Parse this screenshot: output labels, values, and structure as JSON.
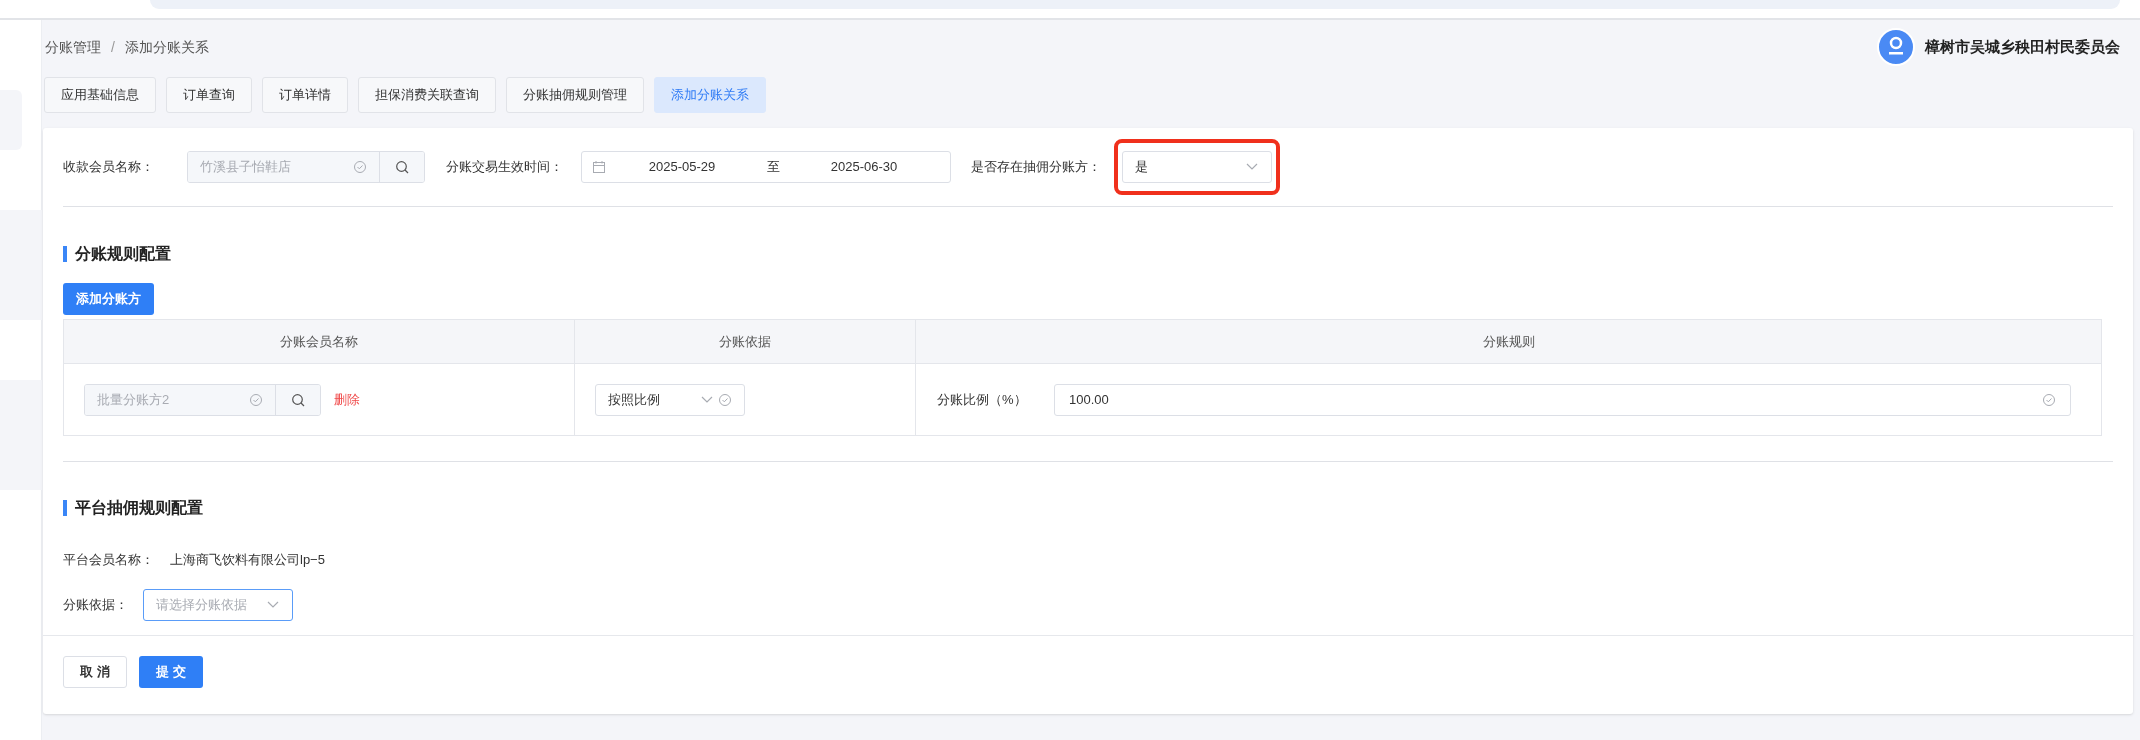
{
  "breadcrumb": {
    "items": [
      "分账管理",
      "添加分账关系"
    ],
    "separator": "/"
  },
  "user": {
    "name": "樟树市吴城乡秧田村民委员会"
  },
  "tabs": [
    {
      "label": "应用基础信息",
      "selected": false
    },
    {
      "label": "订单查询",
      "selected": false
    },
    {
      "label": "订单详情",
      "selected": false
    },
    {
      "label": "担保消费关联查询",
      "selected": false
    },
    {
      "label": "分账抽佣规则管理",
      "selected": false
    },
    {
      "label": "添加分账关系",
      "selected": true
    }
  ],
  "filters": {
    "member": {
      "label": "收款会员名称：",
      "value": "竹溪县子怡鞋店",
      "disabled": true
    },
    "date_range": {
      "label": "分账交易生效时间：",
      "start": "2025-05-29",
      "separator": "至",
      "end": "2025-06-30"
    },
    "commission": {
      "label": "是否存在抽佣分账方：",
      "value": "是",
      "highlighted": true
    }
  },
  "split_rules": {
    "title": "分账规则配置",
    "add_button": "添加分账方",
    "table": {
      "columns": [
        "分账会员名称",
        "分账依据",
        "分账规则"
      ],
      "rows": [
        {
          "member": "批量分账方2",
          "member_disabled": true,
          "delete": "删除",
          "basis": "按照比例",
          "rule_label": "分账比例（%）",
          "rule_value": "100.00"
        }
      ]
    }
  },
  "platform_rules": {
    "title": "平台抽佣规则配置",
    "member_label": "平台会员名称：",
    "member_value": "上海商飞饮料有限公司lp−5",
    "basis_label": "分账依据：",
    "basis_placeholder": "请选择分账依据"
  },
  "footer_buttons": [
    {
      "label": "取 消",
      "kind": "default"
    },
    {
      "label": "提 交",
      "kind": "primary"
    }
  ]
}
